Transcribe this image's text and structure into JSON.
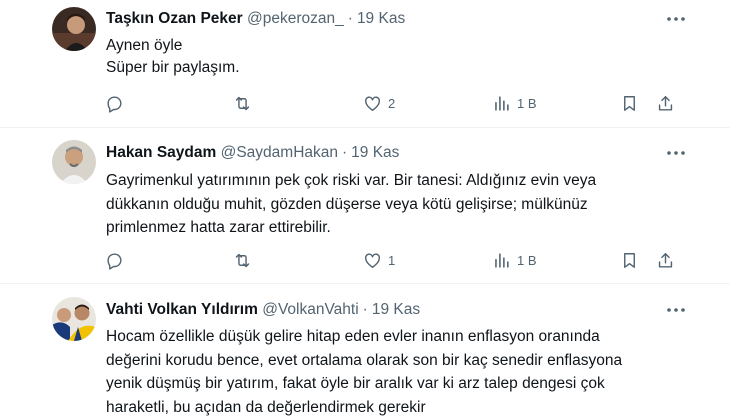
{
  "tweets": [
    {
      "name": "Taşkın Ozan Peker",
      "handle": "@pekerozan_",
      "date": "19 Kas",
      "lines": [
        "Aynen öyle",
        "Süper bir paylaşım."
      ],
      "likes": "2",
      "views": "1 B"
    },
    {
      "name": "Hakan Saydam",
      "handle": "@SaydamHakan",
      "date": "19 Kas",
      "lines": [
        "Gayrimenkul yatırımının pek çok riski var. Bir tanesi: Aldığınız evin veya",
        "dükkanın olduğu muhit, gözden düşerse veya kötü gelişirse; mülkünüz",
        "primlenmez hatta zarar ettirebilir."
      ],
      "likes": "1",
      "views": "1 B"
    },
    {
      "name": "Vahti Volkan Yıldırım",
      "handle": "@VolkanVahti",
      "date": "19 Kas",
      "lines": [
        "Hocam özellikle düşük gelire hitap eden evler inanın enflasyon oranında",
        "değerini korudu bence, evet ortalama olarak son bir kaç senedir enflasyona",
        "yenik düşmüş bir yatırım, fakat öyle bir aralık var ki arz talep dengesi çok",
        "haraketli, bu açıdan da değerlendirmek gerekir"
      ]
    }
  ],
  "separator": "·",
  "icons": [
    "more-icon",
    "reply-icon",
    "retweet-icon",
    "like-icon",
    "views-icon",
    "bookmark-icon",
    "share-icon"
  ]
}
